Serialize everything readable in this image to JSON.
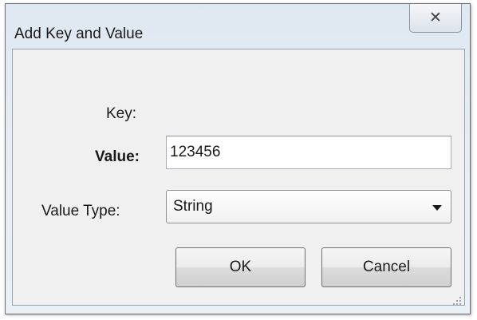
{
  "window": {
    "title": "Add Key and Value",
    "close_glyph": "✕"
  },
  "form": {
    "key_label": "Key:",
    "value_label": "Value:",
    "value_input": "123456",
    "type_label": "Value Type:",
    "type_selected": "String"
  },
  "buttons": {
    "ok": "OK",
    "cancel": "Cancel"
  }
}
